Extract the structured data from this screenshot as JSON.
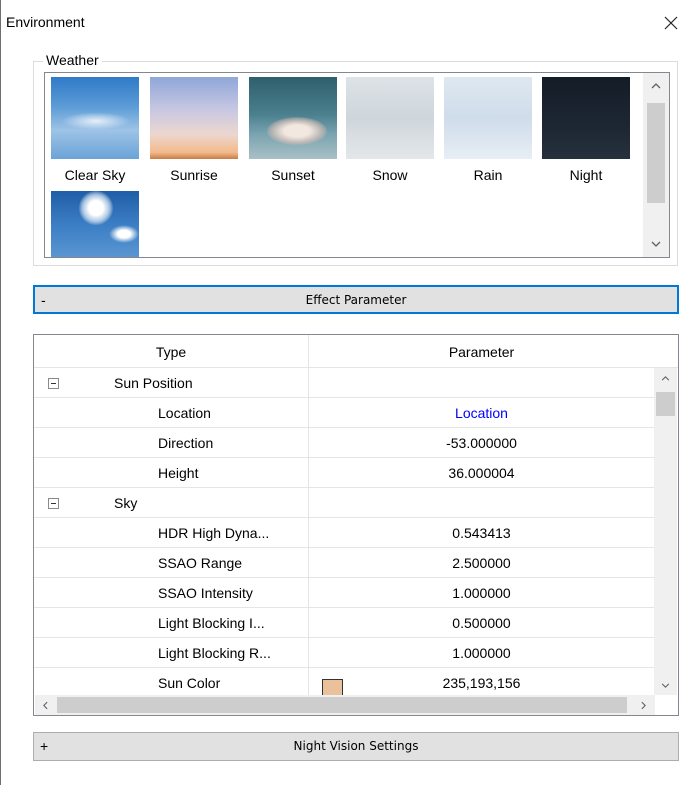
{
  "window": {
    "title": "Environment"
  },
  "weather": {
    "label": "Weather",
    "presets": [
      {
        "label": "Clear Sky"
      },
      {
        "label": "Sunrise"
      },
      {
        "label": "Sunset"
      },
      {
        "label": "Snow"
      },
      {
        "label": "Rain"
      },
      {
        "label": "Night"
      },
      {
        "label": ""
      }
    ]
  },
  "effect_section": {
    "sign": "-",
    "label": "Effect Parameter"
  },
  "grid": {
    "columns": [
      "Type",
      "Parameter"
    ],
    "rows": [
      {
        "kind": "category",
        "name": "Sun Position",
        "value": ""
      },
      {
        "kind": "item",
        "name": "Location",
        "value": "Location"
      },
      {
        "kind": "item",
        "name": "Direction",
        "value": "-53.000000"
      },
      {
        "kind": "item",
        "name": "Height",
        "value": "36.000004"
      },
      {
        "kind": "category",
        "name": "Sky",
        "value": ""
      },
      {
        "kind": "item",
        "name": "HDR High Dyna...",
        "value": "0.543413"
      },
      {
        "kind": "item",
        "name": "SSAO Range",
        "value": "2.500000"
      },
      {
        "kind": "item",
        "name": "SSAO Intensity",
        "value": "1.000000"
      },
      {
        "kind": "item",
        "name": "Light Blocking I...",
        "value": "0.500000"
      },
      {
        "kind": "item",
        "name": "Light Blocking R...",
        "value": "1.000000"
      },
      {
        "kind": "item",
        "name": "Sun Color",
        "value": "235,193,156",
        "swatch_color": "#ebc19c"
      }
    ]
  },
  "night_section": {
    "sign": "+",
    "label": "Night Vision Settings"
  },
  "colors": {
    "focus_border": "#0078d7",
    "link": "#0000ff",
    "button_face": "#e1e1e1"
  }
}
